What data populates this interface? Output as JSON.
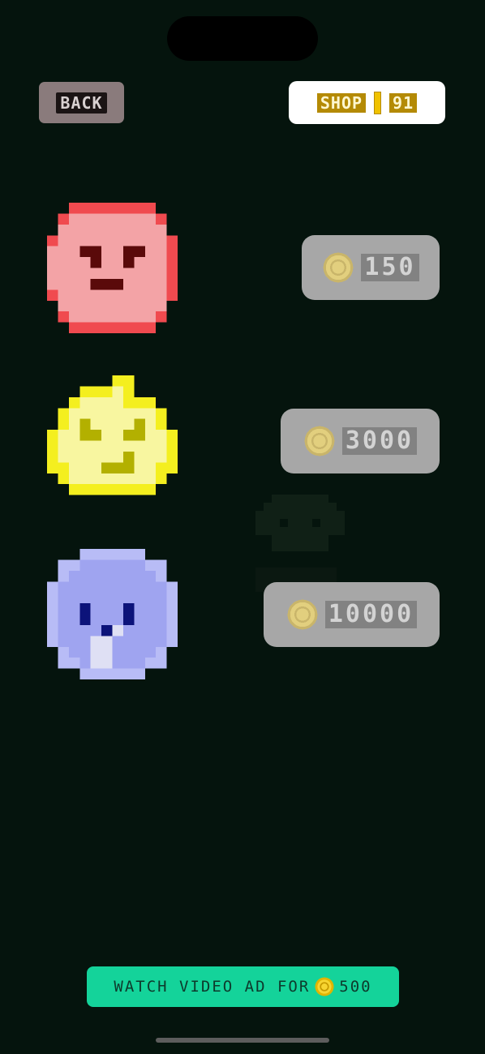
{
  "header": {
    "back_label": "BACK",
    "shop_label": "SHOP",
    "coin_balance": "91"
  },
  "items": [
    {
      "character": "red-angry-blob",
      "price": "150",
      "locked": true
    },
    {
      "character": "yellow-flame-blob",
      "price": "3000",
      "locked": true
    },
    {
      "character": "blue-penguin-blob",
      "price": "10000",
      "locked": true
    }
  ],
  "ad_button": {
    "label": "WATCH VIDEO AD FOR",
    "reward": "500"
  },
  "colors": {
    "background": "#05140d",
    "price_button": "#a7a7a7",
    "ad_button": "#14d39a",
    "shop_accent": "#b48a05"
  }
}
